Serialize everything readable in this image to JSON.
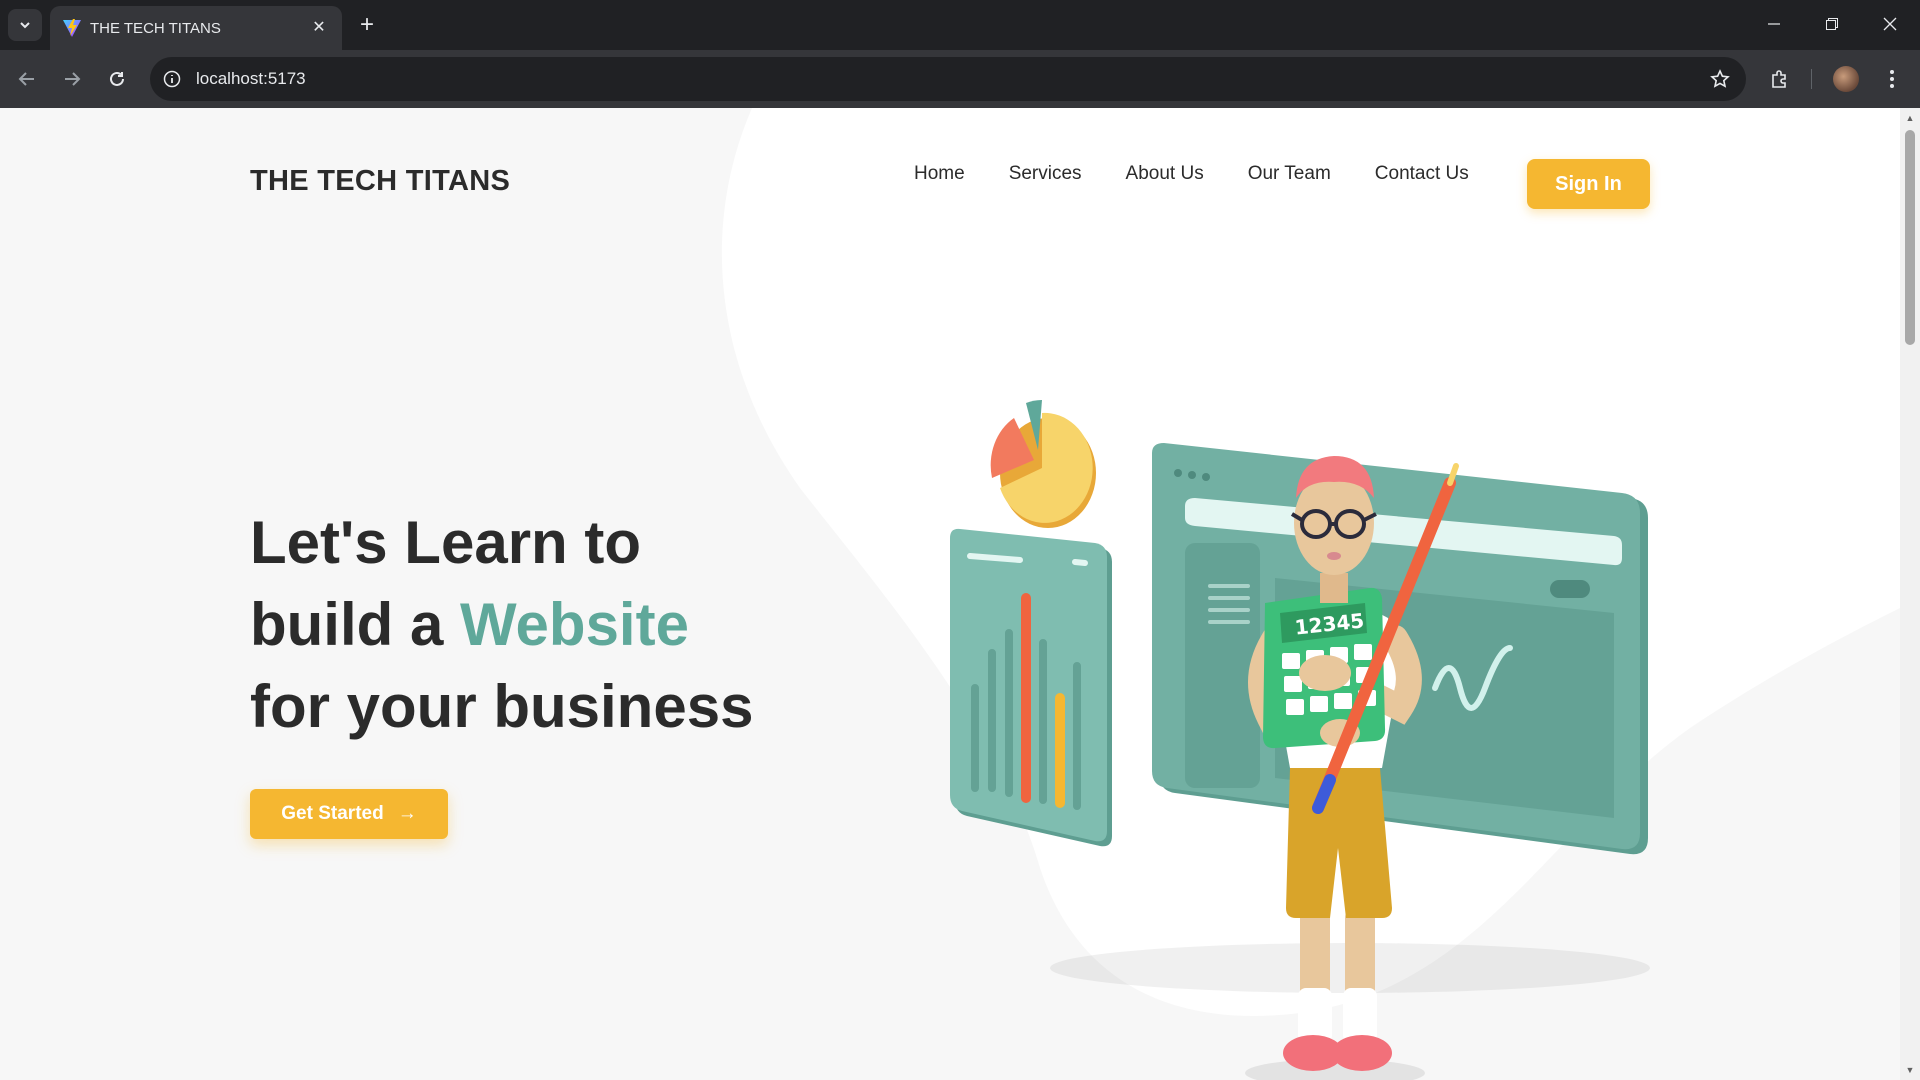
{
  "browser": {
    "tab_title": "THE TECH TITANS",
    "url": "localhost:5173"
  },
  "site": {
    "logo": "THE TECH TITANS",
    "nav": [
      "Home",
      "Services",
      "About Us",
      "Our Team",
      "Contact Us"
    ],
    "signin_label": "Sign In",
    "hero": {
      "line1": "Let's Learn to",
      "line2_prefix": "build a ",
      "line2_accent": "Website",
      "line3": "for your business"
    },
    "cta_label": "Get Started",
    "cta_arrow": "→"
  },
  "colors": {
    "accent": "#f5b731",
    "brand_teal": "#5fa89a",
    "text": "#2b2b2b"
  }
}
